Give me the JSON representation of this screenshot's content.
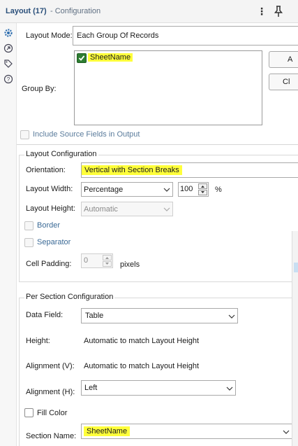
{
  "header": {
    "title": "Layout (17)",
    "subtitle": "- Configuration",
    "more_icon": "more-vertical-icon",
    "pin_icon": "pin-icon"
  },
  "sidebar": {
    "icons": [
      "gear-icon",
      "arrow-circle-icon",
      "tag-icon",
      "help-icon"
    ]
  },
  "layout_mode": {
    "label": "Layout Mode:",
    "value": "Each Group Of Records"
  },
  "group_by": {
    "label": "Group By:",
    "items": [
      {
        "label": "SheetName",
        "checked": true
      }
    ],
    "buttons": [
      "A",
      "Cl"
    ]
  },
  "include_source": {
    "label": "Include Source Fields in Output",
    "checked": false
  },
  "layout_config": {
    "title": "Layout Configuration",
    "orientation_label": "Orientation:",
    "orientation_value": "Vertical with Section Breaks",
    "width_label": "Layout Width:",
    "width_value": "Percentage",
    "width_amount": "100",
    "width_unit": "%",
    "height_label": "Layout Height:",
    "height_value": "Automatic",
    "border_label": "Border",
    "separator_label": "Separator",
    "padding_label": "Cell Padding:",
    "padding_value": "0",
    "padding_unit": "pixels"
  },
  "section_config": {
    "title": "Per Section Configuration",
    "data_field_label": "Data Field:",
    "data_field_value": "Table",
    "height_label": "Height:",
    "height_value": "Automatic to match Layout Height",
    "align_v_label": "Alignment (V):",
    "align_v_value": "Automatic to match Layout Height",
    "align_h_label": "Alignment (H):",
    "align_h_value": "Left",
    "fill_color_label": "Fill Color",
    "section_name_label": "Section Name:",
    "section_name_value": "SheetName"
  },
  "colors": {
    "accent": "#2a4f7a",
    "highlight": "#ffff3a",
    "check": "#2e7d32"
  }
}
